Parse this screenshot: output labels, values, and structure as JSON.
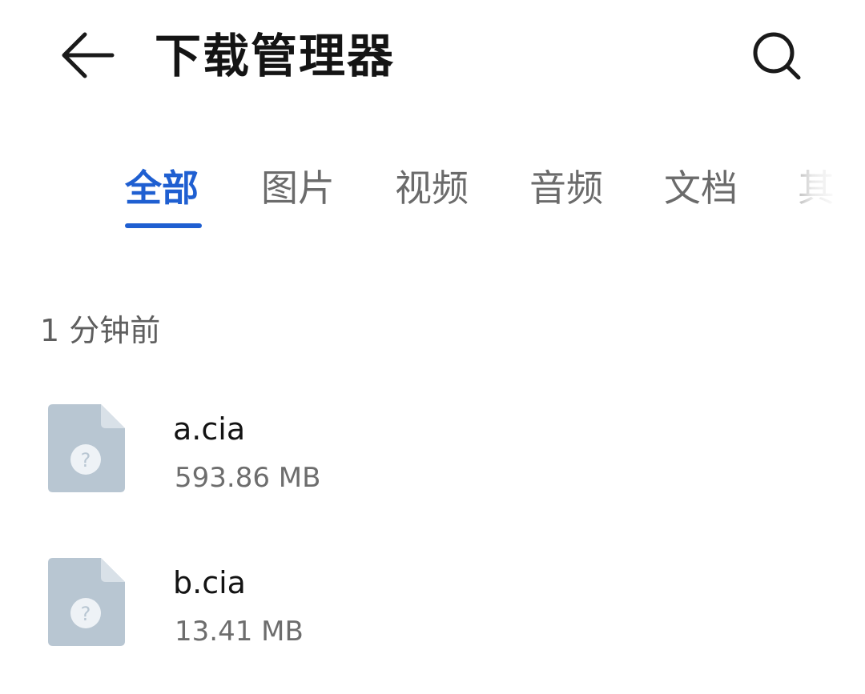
{
  "header": {
    "title": "下载管理器",
    "back_icon": "arrow-left-icon",
    "search_icon": "search-icon"
  },
  "tabs": [
    {
      "label": "全部",
      "active": true
    },
    {
      "label": "图片",
      "active": false
    },
    {
      "label": "视频",
      "active": false
    },
    {
      "label": "音频",
      "active": false
    },
    {
      "label": "文档",
      "active": false
    },
    {
      "label": "其",
      "active": false
    }
  ],
  "sections": [
    {
      "title": "1 分钟前",
      "files": [
        {
          "name": "a.cia",
          "size": "593.86 MB",
          "icon": "unknown-file-icon"
        },
        {
          "name": "b.cia",
          "size": "13.41 MB",
          "icon": "unknown-file-icon"
        }
      ]
    }
  ],
  "colors": {
    "accent": "#1f5fd1",
    "tab_inactive": "#6b6b6b",
    "file_icon": "#b8c6d2",
    "file_icon_fold": "#d9e1e8"
  }
}
